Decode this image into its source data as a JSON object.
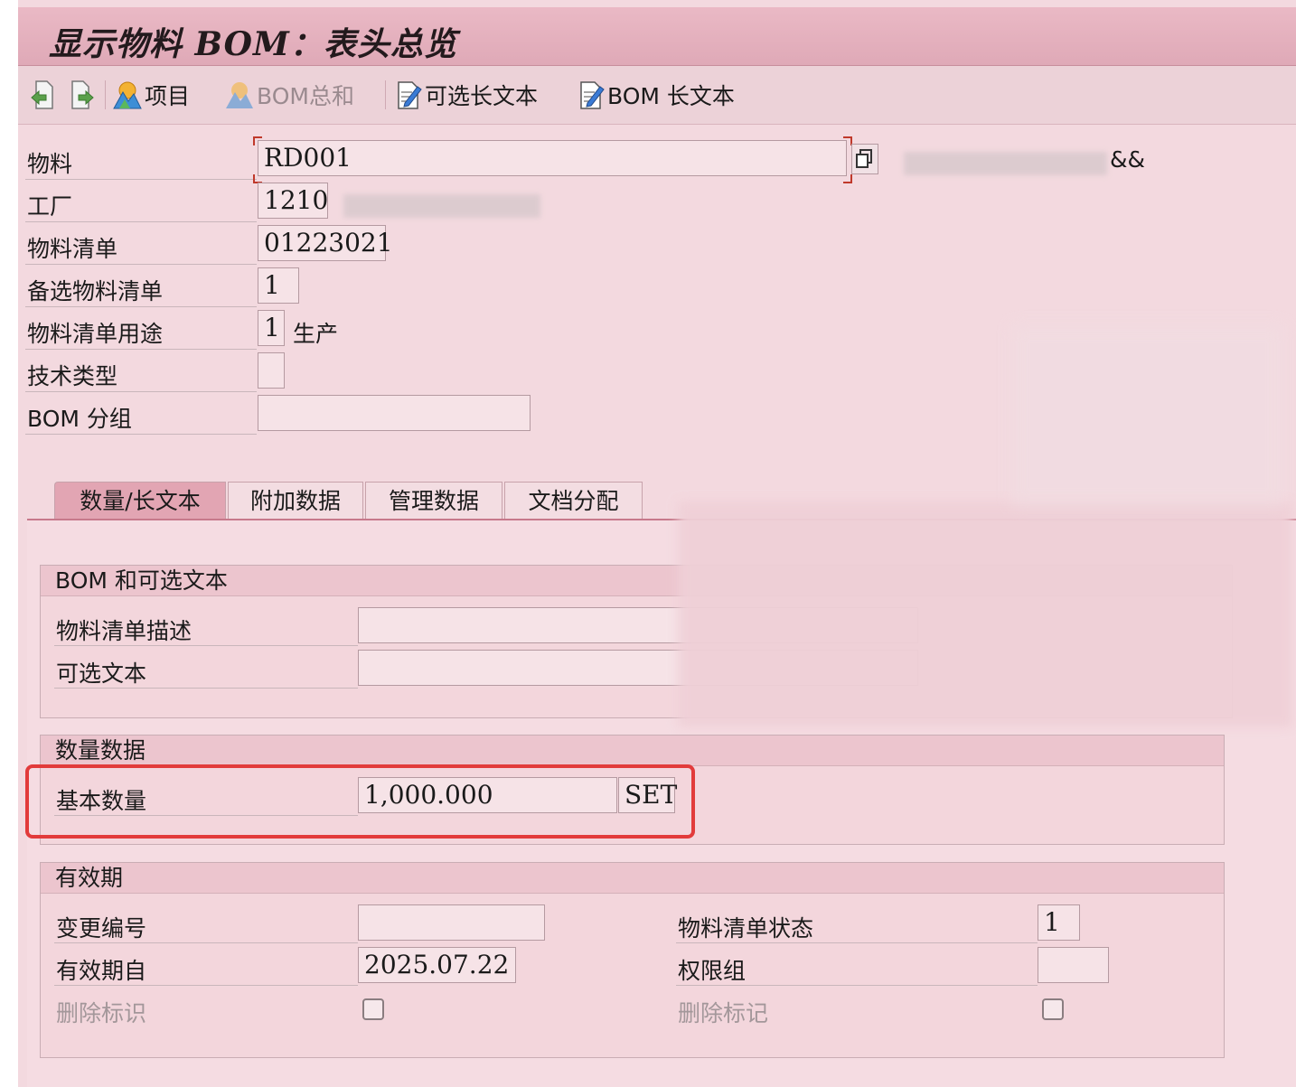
{
  "window": {
    "title": "显示物料 BOM：表头总览"
  },
  "toolbar": {
    "items_label": "项目",
    "bom_sum_label": "BOM总和",
    "alt_long_text_label": "可选长文本",
    "bom_long_text_label": "BOM 长文本"
  },
  "header": {
    "material_label": "物料",
    "material_value": "RD001",
    "material_desc_suffix": "&&",
    "plant_label": "工厂",
    "plant_value": "1210",
    "bom_label": "物料清单",
    "bom_value": "01223021",
    "alt_bom_label": "备选物料清单",
    "alt_bom_value": "1",
    "bom_usage_label": "物料清单用途",
    "bom_usage_value": "1",
    "bom_usage_text": "生产",
    "tech_type_label": "技术类型",
    "tech_type_value": "",
    "bom_group_label": "BOM 分组",
    "bom_group_value": ""
  },
  "tabs": [
    {
      "label": "数量/长文本",
      "active": true
    },
    {
      "label": "附加数据",
      "active": false
    },
    {
      "label": "管理数据",
      "active": false
    },
    {
      "label": "文档分配",
      "active": false
    }
  ],
  "bom_text_group": {
    "title": "BOM 和可选文本",
    "desc_label": "物料清单描述",
    "desc_value": "",
    "alt_text_label": "可选文本",
    "alt_text_value": ""
  },
  "quantity_group": {
    "title": "数量数据",
    "base_qty_label": "基本数量",
    "base_qty_value": "1,000.000",
    "unit_value": "SET"
  },
  "validity_group": {
    "title": "有效期",
    "change_no_label": "变更编号",
    "change_no_value": "",
    "valid_from_label": "有效期自",
    "valid_from_value": "2025.07.22",
    "deletion_flag_label": "删除标识",
    "bom_status_label": "物料清单状态",
    "bom_status_value": "1",
    "auth_group_label": "权限组",
    "auth_group_value": "",
    "deletion_mark_label": "删除标记"
  },
  "colors": {
    "highlight": "#e23b3b",
    "title_bar": "#e4b0bd",
    "panel": "#f5dce2"
  }
}
